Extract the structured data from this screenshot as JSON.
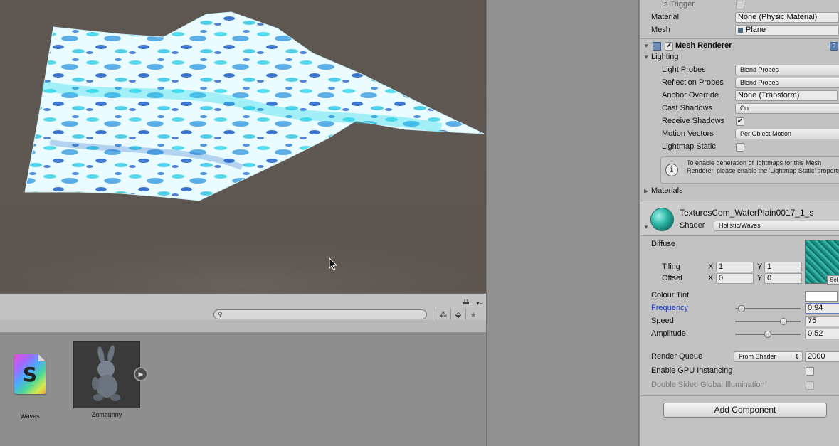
{
  "project": {
    "assets": [
      {
        "name": "Waves",
        "icon_letter": "S",
        "icon": "shader-file-icon"
      },
      {
        "name": "Zombunny",
        "icon": "model-thumbnail"
      }
    ],
    "toolbar_icons": [
      "filter-by-type-icon",
      "filter-by-label-icon",
      "favorites-star-icon"
    ]
  },
  "inspector": {
    "collider": {
      "is_trigger_label": "Is Trigger",
      "material_label": "Material",
      "material_value": "None (Physic Material)",
      "mesh_label": "Mesh",
      "mesh_value": "Plane"
    },
    "mesh_renderer": {
      "title": "Mesh Renderer",
      "enabled": true,
      "lighting_label": "Lighting",
      "light_probes_label": "Light Probes",
      "light_probes_value": "Blend Probes",
      "reflection_probes_label": "Reflection Probes",
      "reflection_probes_value": "Blend Probes",
      "anchor_override_label": "Anchor Override",
      "anchor_override_value": "None (Transform)",
      "cast_shadows_label": "Cast Shadows",
      "cast_shadows_value": "On",
      "receive_shadows_label": "Receive Shadows",
      "receive_shadows": true,
      "motion_vectors_label": "Motion Vectors",
      "motion_vectors_value": "Per Object Motion",
      "lightmap_static_label": "Lightmap Static",
      "lightmap_static": false,
      "help_text": "To enable generation of lightmaps for this Mesh Renderer, please enable the 'Lightmap Static' property.",
      "materials_label": "Materials"
    },
    "material": {
      "name": "TexturesCom_WaterPlain0017_1_s",
      "shader_label": "Shader",
      "shader_value": "Holistic/Waves",
      "diffuse_label": "Diffuse",
      "tiling_label": "Tiling",
      "offset_label": "Offset",
      "x_label": "X",
      "y_label": "Y",
      "tiling_x": "1",
      "tiling_y": "1",
      "offset_x": "0",
      "offset_y": "0",
      "texture_select_label": "Sel",
      "colour_tint_label": "Colour Tint",
      "colour_tint": "#ffffff",
      "frequency_label": "Frequency",
      "frequency_value": "0.94",
      "frequency_level": 0.1,
      "speed_label": "Speed",
      "speed_value": "75",
      "speed_level": 0.74,
      "amplitude_label": "Amplitude",
      "amplitude_value": "0.52",
      "amplitude_level": 0.5,
      "render_queue_label": "Render Queue",
      "render_queue_mode": "From Shader",
      "render_queue_value": "2000",
      "gpu_instancing_label": "Enable GPU Instancing",
      "double_sided_gi_label": "Double Sided Global Illumination"
    },
    "add_component_label": "Add Component"
  },
  "colors": {
    "accent_link": "#1f3ccf",
    "scene_bg": "#5e5650",
    "water_light": "#e8fbff",
    "water_cyan": "#22d4e6",
    "water_deep": "#1561c9"
  }
}
